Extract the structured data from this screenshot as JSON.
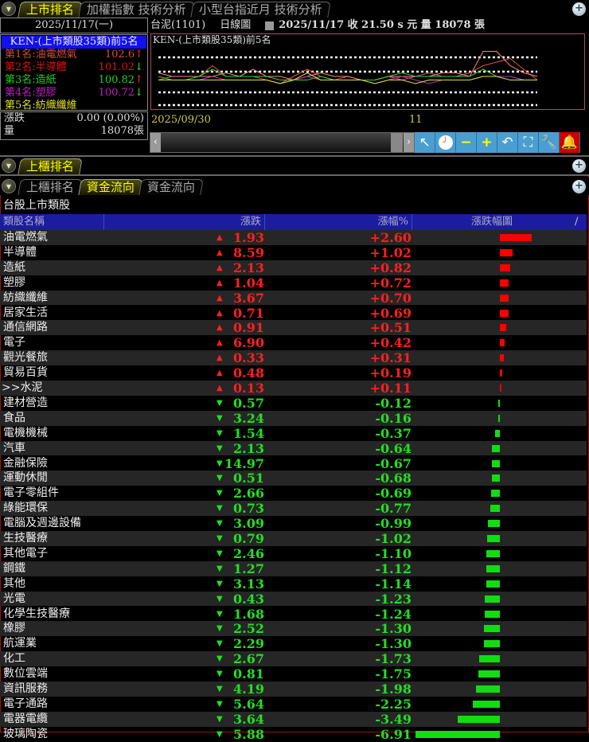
{
  "top": {
    "tabs": [
      "上市排名",
      "加權指數 技術分析",
      "小型台指近月 技術分析"
    ],
    "date": "2025/11/17(一)",
    "list_title": "KEN-(上市類股35類)前5名",
    "ranks": [
      {
        "label": "第1名:油電燃氣",
        "value": "102.6",
        "dir": "up",
        "color": "#d05030"
      },
      {
        "label": "第2名:半導體",
        "value": "101.02",
        "dir": "down",
        "color": "#e01010"
      },
      {
        "label": "第3名:造紙",
        "value": "100.82",
        "dir": "up",
        "color": "#20d020"
      },
      {
        "label": "第4名:塑膠",
        "value": "100.72",
        "dir": "down",
        "color": "#c020c0"
      },
      {
        "label": "第5名:紡織纖維",
        "value": "",
        "dir": "",
        "color": "#e0e020"
      }
    ],
    "change_label": "漲跌",
    "change_value": "0.00 (0.00%)",
    "volume_label": "量",
    "volume_value": "18078張",
    "stock": "台泥(1101)",
    "chart_type": "日線圖",
    "info": "2025/11/17  收 21.50 s 元  量 18078 張",
    "chart_title": "KEN-(上市類股35類)前5名",
    "x_start": "2025/09/30",
    "x_mid": "11"
  },
  "chart_data": {
    "type": "line",
    "series": [
      {
        "name": "油電燃氣",
        "color": "#e05050",
        "values": [
          1,
          2,
          2,
          2,
          5,
          2,
          2,
          2,
          1,
          0,
          2,
          4,
          2,
          1,
          2,
          1,
          1,
          2,
          1,
          2,
          3,
          2,
          2,
          3,
          5,
          6,
          7,
          4,
          1
        ]
      },
      {
        "name": "半導體",
        "color": "#ff8080",
        "values": [
          3,
          2,
          2,
          2,
          2,
          3,
          2,
          4,
          2,
          2,
          1,
          2,
          3,
          2,
          2,
          1,
          1,
          2,
          2,
          2,
          2,
          3,
          3,
          2,
          9,
          9,
          5,
          3,
          2
        ]
      },
      {
        "name": "造紙",
        "color": "#30d030",
        "values": [
          2,
          1,
          1,
          2,
          4,
          2,
          2,
          2,
          2,
          1,
          1,
          1,
          2,
          1,
          1,
          1,
          1,
          2,
          3,
          2,
          2,
          2,
          2,
          2,
          4,
          2,
          2,
          1,
          1
        ]
      },
      {
        "name": "塑膠",
        "color": "#c030c0",
        "values": [
          1,
          1,
          1,
          1,
          2,
          1,
          1,
          1,
          1,
          0,
          1,
          2,
          1,
          1,
          1,
          1,
          0,
          1,
          2,
          1,
          0,
          1,
          1,
          1,
          2,
          2,
          2,
          1,
          1
        ]
      },
      {
        "name": "紡織纖維",
        "color": "#e0e040",
        "values": [
          1,
          1,
          1,
          1,
          1,
          1,
          1,
          1,
          1,
          0,
          1,
          3,
          1,
          1,
          1,
          1,
          0,
          1,
          1,
          0,
          1,
          1,
          1,
          1,
          2,
          2,
          1,
          1,
          1
        ]
      }
    ]
  },
  "otc": {
    "tab": "上櫃排名"
  },
  "flow": {
    "tabs": [
      "上櫃排名",
      "資金流向",
      "資金流向"
    ],
    "title": "台股上市類股",
    "headers": [
      "類股名稱",
      "漲跌",
      "漲幅%",
      "漲跌幅圖"
    ],
    "sort_marker": "/",
    "rows": [
      [
        "油電燃氣",
        "1.93",
        "+2.60"
      ],
      [
        "半導體",
        "8.59",
        "+1.02"
      ],
      [
        "造紙",
        "2.13",
        "+0.82"
      ],
      [
        "塑膠",
        "1.04",
        "+0.72"
      ],
      [
        "紡織纖維",
        "3.67",
        "+0.70"
      ],
      [
        "居家生活",
        "0.71",
        "+0.69"
      ],
      [
        "通信網路",
        "0.91",
        "+0.51"
      ],
      [
        "電子",
        "6.90",
        "+0.42"
      ],
      [
        "觀光餐旅",
        "0.33",
        "+0.31"
      ],
      [
        "貿易百貨",
        "0.48",
        "+0.19"
      ],
      [
        ">>水泥",
        "0.13",
        "+0.11"
      ],
      [
        "建材營造",
        "0.57",
        "-0.12"
      ],
      [
        "食品",
        "3.24",
        "-0.16"
      ],
      [
        "電機機械",
        "1.54",
        "-0.37"
      ],
      [
        "汽車",
        "2.13",
        "-0.64"
      ],
      [
        "金融保險",
        "14.97",
        "-0.67"
      ],
      [
        "運動休閒",
        "0.51",
        "-0.68"
      ],
      [
        "電子零組件",
        "2.66",
        "-0.69"
      ],
      [
        "綠能環保",
        "0.73",
        "-0.77"
      ],
      [
        "電腦及週邊設備",
        "3.09",
        "-0.99"
      ],
      [
        "生技醫療",
        "0.79",
        "-1.02"
      ],
      [
        "其他電子",
        "2.46",
        "-1.10"
      ],
      [
        "鋼鐵",
        "1.27",
        "-1.12"
      ],
      [
        "其他",
        "3.13",
        "-1.14"
      ],
      [
        "光電",
        "0.43",
        "-1.23"
      ],
      [
        "化學生技醫療",
        "1.68",
        "-1.24"
      ],
      [
        "橡膠",
        "2.52",
        "-1.30"
      ],
      [
        "航運業",
        "2.29",
        "-1.30"
      ],
      [
        "化工",
        "2.67",
        "-1.73"
      ],
      [
        "數位雲端",
        "0.81",
        "-1.75"
      ],
      [
        "資訊服務",
        "4.19",
        "-1.98"
      ],
      [
        "電子通路",
        "5.64",
        "-2.25"
      ],
      [
        "電器電纜",
        "3.64",
        "-3.49"
      ],
      [
        "玻璃陶瓷",
        "5.88",
        "-6.91"
      ]
    ]
  },
  "colors": {
    "up": "#ff2020",
    "down": "#20e020",
    "header": "#1c1ca0"
  }
}
